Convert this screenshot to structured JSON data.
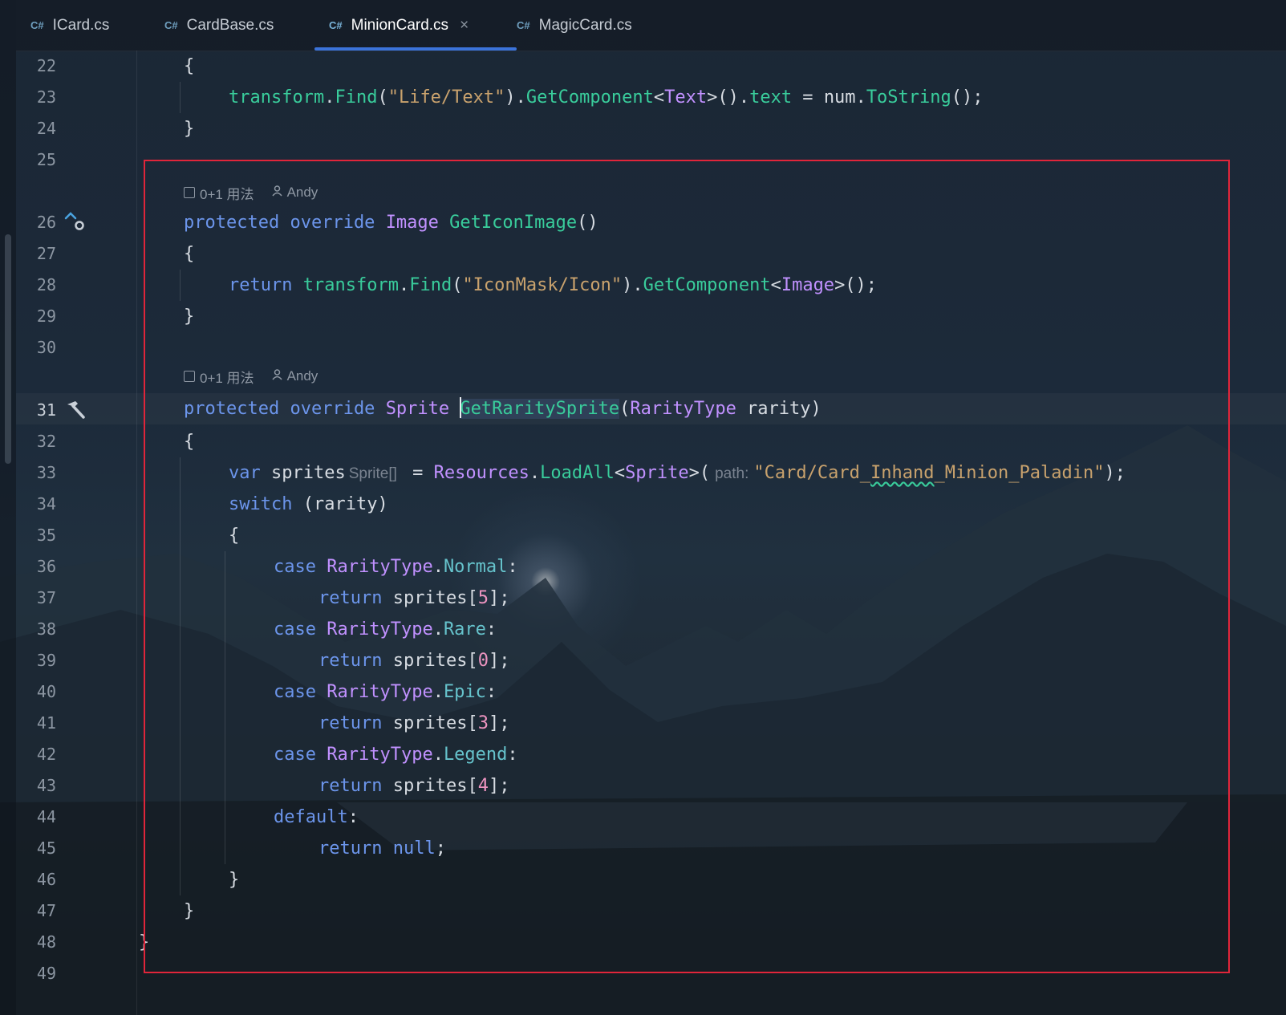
{
  "tabs": [
    {
      "badge": "C#",
      "label": "ICard.cs"
    },
    {
      "badge": "C#",
      "label": "CardBase.cs"
    },
    {
      "badge": "C#",
      "label": "MinionCard.cs",
      "active": true,
      "close": "×"
    },
    {
      "badge": "C#",
      "label": "MagicCard.cs"
    }
  ],
  "gutter": {
    "line_numbers": [
      "22",
      "23",
      "24",
      "25",
      "26",
      "27",
      "28",
      "29",
      "30",
      "31",
      "32",
      "33",
      "34",
      "35",
      "36",
      "37",
      "38",
      "39",
      "40",
      "41",
      "42",
      "43",
      "44",
      "45",
      "46",
      "47",
      "48",
      "49"
    ]
  },
  "code_lens": [
    {
      "usages": "0+1 用法",
      "author": "Andy"
    },
    {
      "usages": "0+1 用法",
      "author": "Andy"
    }
  ],
  "code": {
    "l22": {
      "brace": "{"
    },
    "l23": {
      "t1": "transform",
      "dot1": ".",
      "find": "Find",
      "p1": "(",
      "str": "\"Life/Text\"",
      "p2": ").",
      "gc": "GetComponent",
      "lt": "<",
      "type": "Text",
      "gt": ">().",
      "prop": "text",
      "eq": " = ",
      "var": "num",
      "dot2": ".",
      "ts": "ToString",
      "end": "();"
    },
    "l24": {
      "brace": "}"
    },
    "l26": {
      "k1": "protected",
      "k2": "override",
      "type": "Image",
      "name": "GetIconImage",
      "end": "()"
    },
    "l27": {
      "brace": "{"
    },
    "l28": {
      "ret": "return",
      "t1": "transform",
      "dot1": ".",
      "find": "Find",
      "p1": "(",
      "str": "\"IconMask/Icon\"",
      "p2": ").",
      "gc": "GetComponent",
      "lt": "<",
      "type": "Image",
      "end": ">();"
    },
    "l29": {
      "brace": "}"
    },
    "l31": {
      "k1": "protected",
      "k2": "override",
      "type": "Sprite",
      "name": "GetRaritySprite",
      "p1": "(",
      "ptype": "RarityType",
      "param": " rarity",
      "p2": ")"
    },
    "l32": {
      "brace": "{"
    },
    "l33": {
      "kvar": "var",
      "name": " sprites",
      "hint": "Sprite[]",
      "eq": " = ",
      "res": "Resources",
      "dot": ".",
      "la": "LoadAll",
      "lt": "<",
      "type": "Sprite",
      "p1": ">(",
      "phint": "path:",
      "str1": "\"Card/Card_",
      "str2": "Inhand",
      "str3": "_Minion_Paladin\"",
      "end": ");"
    },
    "l34": {
      "ksw": "switch",
      "rest": " (rarity)"
    },
    "l35": {
      "brace": "{"
    },
    "l36": {
      "kcase": "case",
      "type": "RarityType",
      "dot": ".",
      "val": "Normal",
      "colon": ":"
    },
    "l37": {
      "ret": "return",
      "pre": " sprites[",
      "num": "5",
      "end": "];"
    },
    "l38": {
      "kcase": "case",
      "type": "RarityType",
      "dot": ".",
      "val": "Rare",
      "colon": ":"
    },
    "l39": {
      "ret": "return",
      "pre": " sprites[",
      "num": "0",
      "end": "];"
    },
    "l40": {
      "kcase": "case",
      "type": "RarityType",
      "dot": ".",
      "val": "Epic",
      "colon": ":"
    },
    "l41": {
      "ret": "return",
      "pre": " sprites[",
      "num": "3",
      "end": "];"
    },
    "l42": {
      "kcase": "case",
      "type": "RarityType",
      "dot": ".",
      "val": "Legend",
      "colon": ":"
    },
    "l43": {
      "ret": "return",
      "pre": " sprites[",
      "num": "4",
      "end": "];"
    },
    "l44": {
      "kdef": "default",
      "colon": ":"
    },
    "l45": {
      "ret": "return",
      "knull": "null",
      "end": ";"
    },
    "l46": {
      "brace": "}"
    },
    "l47": {
      "brace": "}"
    },
    "l48": {
      "brace": "}"
    }
  },
  "colors": {
    "keyword": "#6c95eb",
    "type": "#c191ff",
    "method": "#39cc9b",
    "string": "#c9a26d",
    "number": "#ed94c0",
    "enum_member": "#66c3cc",
    "highlight_box": "#e0253a",
    "active_tab_underline": "#3b73d9"
  },
  "icons": {
    "line26": "override-arrow-icon",
    "line31": "hammer-icon"
  }
}
